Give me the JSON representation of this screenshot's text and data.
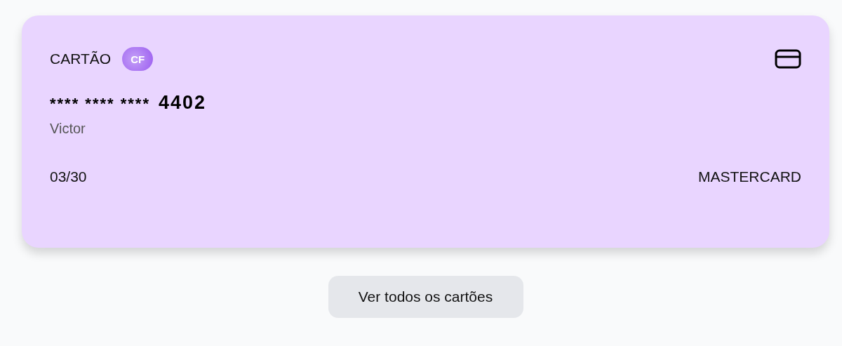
{
  "card": {
    "label": "CARTÃO",
    "logo": "CF",
    "masked": "**** **** ****",
    "last_digits": "4402",
    "holder": "Victor",
    "expiry": "03/30",
    "brand": "MASTERCARD"
  },
  "button": "Ver todos os cartões"
}
